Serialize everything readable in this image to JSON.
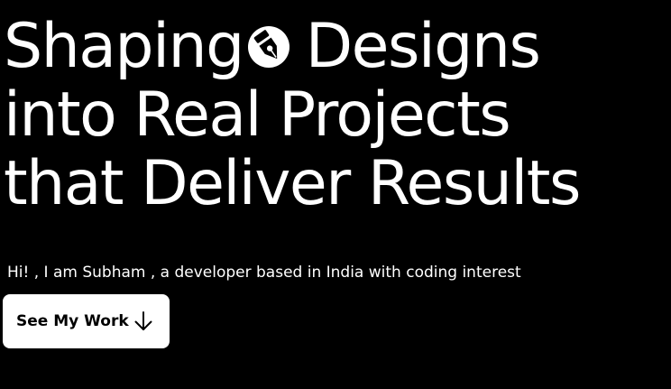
{
  "hero": {
    "headline": {
      "line1_start": "Shaping",
      "line1_end": "Designs",
      "line2": "into Real Projects",
      "line3": "that Deliver Results"
    },
    "emblem_icon": "pen-tool-badge-icon",
    "intro": "Hi! , I am Subham , a developer based in India with coding interest",
    "cta": {
      "label": "See My Work",
      "icon": "arrow-down-icon"
    }
  },
  "colors": {
    "background": "#000000",
    "text": "#ffffff",
    "button_background": "#ffffff",
    "button_text": "#000000"
  }
}
